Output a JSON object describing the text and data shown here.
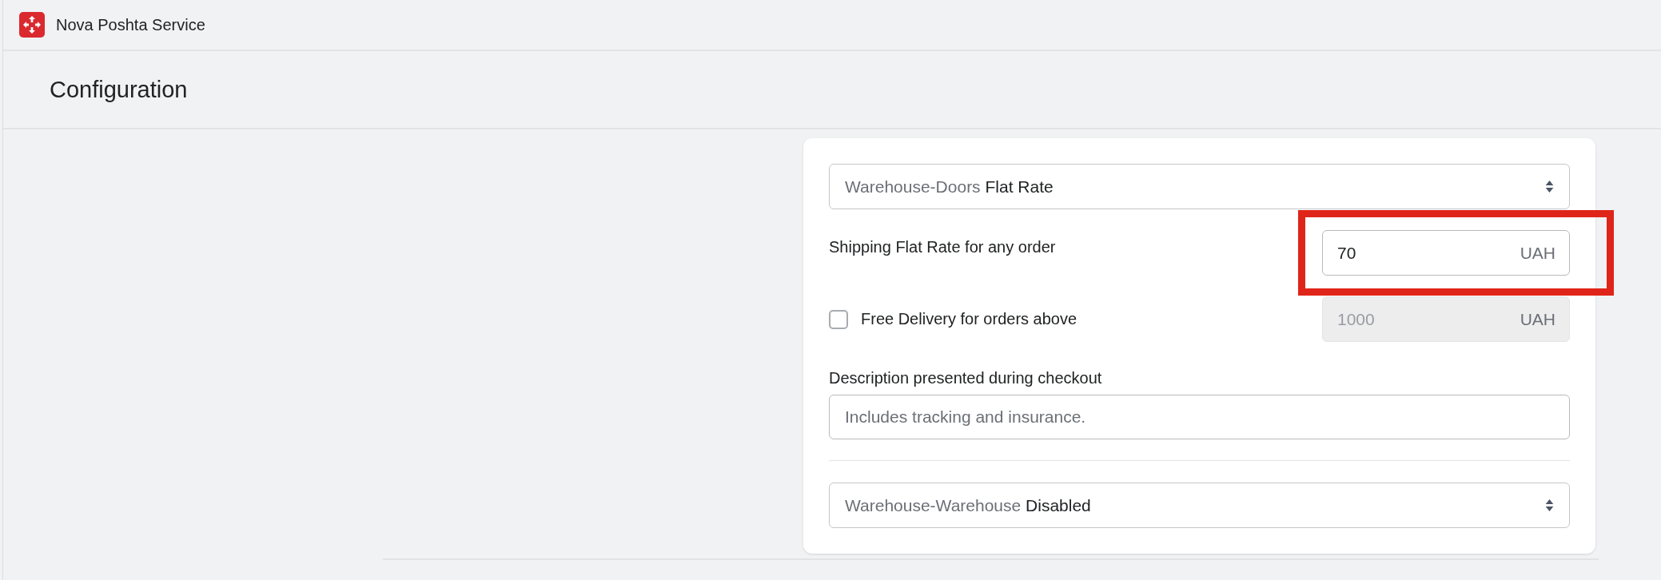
{
  "app_bar": {
    "title": "Nova Poshta Service"
  },
  "page": {
    "title": "Configuration"
  },
  "form": [
    {
      "kind": "select",
      "label": "Warehouse-Doors",
      "value": "Flat Rate"
    },
    {
      "kind": "amount",
      "label": "Shipping Flat Rate for any order",
      "value": "70",
      "suffix": "UAH",
      "disabled": false,
      "highlighted": true
    },
    {
      "kind": "check_amount",
      "label": "Free Delivery for orders above",
      "checked": false,
      "placeholder": "1000",
      "suffix": "UAH",
      "disabled": true
    },
    {
      "kind": "text",
      "label": "Description presented during checkout",
      "placeholder": "Includes tracking and insurance."
    },
    {
      "kind": "divider"
    },
    {
      "kind": "select",
      "label": "Warehouse-Warehouse",
      "value": "Disabled"
    }
  ]
}
